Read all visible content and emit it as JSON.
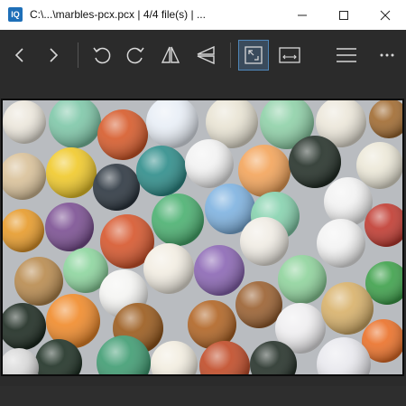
{
  "titlebar": {
    "title": "C:\\...\\marbles-pcx.pcx  |  4/4 file(s)  |  ...",
    "app_icon_letter": "lQ",
    "buttons": [
      {
        "name": "minimize",
        "icon": "minimize-icon"
      },
      {
        "name": "maximize",
        "icon": "maximize-icon"
      },
      {
        "name": "close",
        "icon": "close-icon"
      }
    ]
  },
  "toolbar": {
    "buttons": [
      {
        "name": "previous",
        "icon": "chevron-left-icon"
      },
      {
        "name": "next",
        "icon": "chevron-right-icon"
      },
      {
        "name": "rotate-left",
        "icon": "rotate-left-icon"
      },
      {
        "name": "rotate-right",
        "icon": "rotate-right-icon"
      },
      {
        "name": "flip-horizontal",
        "icon": "flip-horizontal-icon"
      },
      {
        "name": "flip-vertical",
        "icon": "flip-vertical-icon"
      },
      {
        "name": "auto-zoom",
        "icon": "fit-height-icon",
        "active": true
      },
      {
        "name": "scale-to-width",
        "icon": "fit-width-icon"
      },
      {
        "name": "main-menu",
        "icon": "hamburger-menu-icon"
      },
      {
        "name": "more",
        "icon": "more-dots-icon"
      }
    ]
  },
  "image": {
    "subject": "marbles photo",
    "colors": {
      "background": "#2b2b2b",
      "accent": "#4f86b8"
    }
  }
}
